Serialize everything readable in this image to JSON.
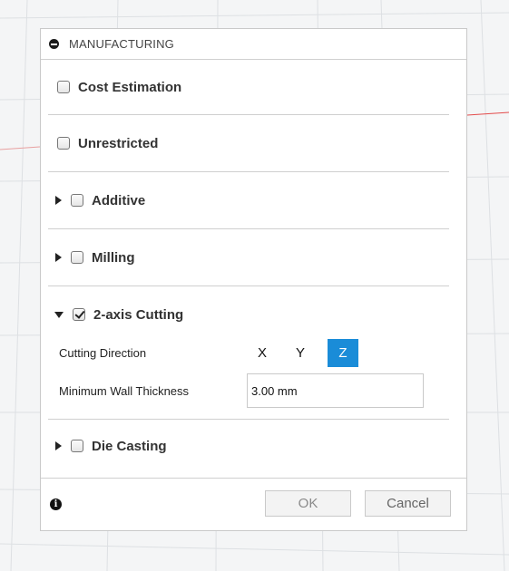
{
  "panel": {
    "header": {
      "title": "MANUFACTURING"
    },
    "sections": {
      "cost_estimation": {
        "label": "Cost Estimation",
        "checked": false
      },
      "unrestricted": {
        "label": "Unrestricted",
        "checked": false
      },
      "additive": {
        "label": "Additive",
        "checked": false,
        "expanded": false
      },
      "milling": {
        "label": "Milling",
        "checked": false,
        "expanded": false
      },
      "two_axis_cutting": {
        "label": "2-axis Cutting",
        "checked": true,
        "expanded": true,
        "cutting_direction": {
          "label": "Cutting Direction",
          "options": [
            "X",
            "Y",
            "Z"
          ],
          "selected": "Z"
        },
        "min_wall_thickness": {
          "label": "Minimum Wall Thickness",
          "value": "3.00 mm"
        }
      },
      "die_casting": {
        "label": "Die Casting",
        "checked": false,
        "expanded": false
      }
    },
    "footer": {
      "ok_label": "OK",
      "cancel_label": "Cancel"
    }
  },
  "colors": {
    "accent": "#1a8cd8",
    "canvas_axis_red": "#e34b4b"
  }
}
